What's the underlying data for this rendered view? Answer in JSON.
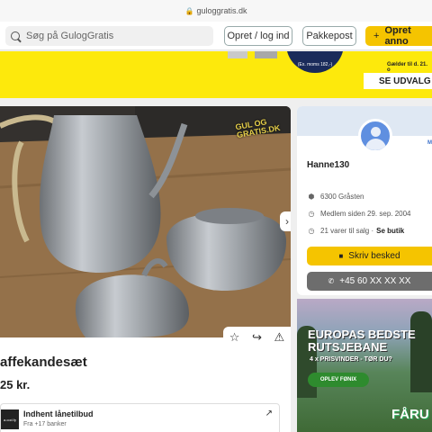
{
  "browser": {
    "url": "guloggratis.dk"
  },
  "header": {
    "search_placeholder": "Søg på GulogGratis",
    "login_label": "Opret / log ind",
    "pakkepost_label": "Pakkepost",
    "opret_label": "Opret anno"
  },
  "banner": {
    "price_note": "(Ex. moms 182,-)",
    "offer_text": "Gælder til d. 21. o",
    "button_label": "SE UDVALG"
  },
  "listing": {
    "title": "affekandesæt",
    "price": "25 kr.",
    "watermark": "GUL OG GRATIS.DK",
    "loan": {
      "title": "Indhent lånetilbud",
      "subtitle": "Fra +17 banker",
      "logo_text": "a.cod.fy"
    }
  },
  "seller": {
    "badge_text": "M",
    "username": "Hanne130",
    "location": "6300 Gråsten",
    "member_since": "Medlem siden 29. sep. 2004",
    "items_for_sale": "21 varer til salg ·",
    "shop_link": "Se butik",
    "message_button": "Skriv besked",
    "phone_button": "+45 60 XX XX XX"
  },
  "ad": {
    "headline_line1": "EUROPAS BEDSTE",
    "headline_line2": "RUTSJEBANE",
    "subline": "4 x PRISVINDER - TØR DU?",
    "cta": "OPLEV FØNIX",
    "brand": "FÅRU"
  }
}
